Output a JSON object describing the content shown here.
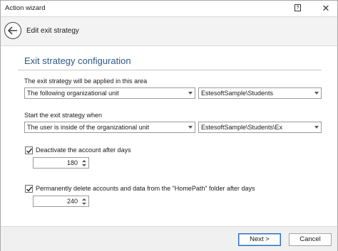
{
  "window": {
    "title": "Action wizard",
    "help_glyph": "?",
    "close_glyph": "✕"
  },
  "header": {
    "title": "Edit exit strategy"
  },
  "section": {
    "title": "Exit strategy configuration"
  },
  "area": {
    "label": "The exit strategy will be applied in this area",
    "scope_value": "The following organizational unit",
    "ou_value": "EstesoftSample\\Students"
  },
  "start": {
    "label": "Start the exit strategy when",
    "condition_value": "The user is inside of the organizational unit",
    "ou_value": "EstesoftSample\\Students\\Ex"
  },
  "deactivate": {
    "label": "Deactivate the account after days",
    "checked": true,
    "days": "180"
  },
  "delete": {
    "label": "Permanently delete accounts and data from the \"HomePath\" folder after days",
    "checked": true,
    "days": "240"
  },
  "footer": {
    "next_label": "Next >",
    "cancel_label": "Cancel"
  }
}
